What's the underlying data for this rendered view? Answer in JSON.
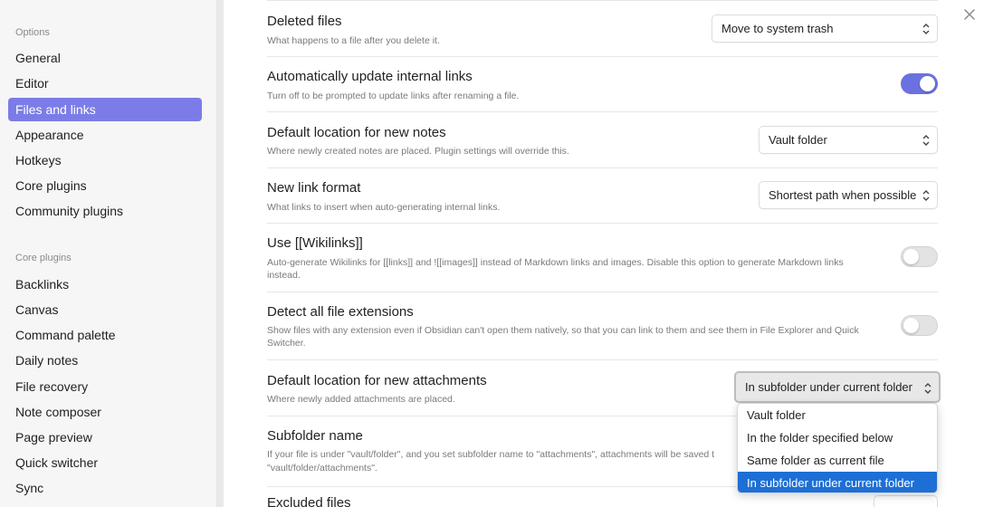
{
  "sidebar": {
    "options_heading": "Options",
    "options_items": [
      {
        "label": "General"
      },
      {
        "label": "Editor"
      },
      {
        "label": "Files and links"
      },
      {
        "label": "Appearance"
      },
      {
        "label": "Hotkeys"
      },
      {
        "label": "Core plugins"
      },
      {
        "label": "Community plugins"
      }
    ],
    "core_heading": "Core plugins",
    "core_items": [
      {
        "label": "Backlinks"
      },
      {
        "label": "Canvas"
      },
      {
        "label": "Command palette"
      },
      {
        "label": "Daily notes"
      },
      {
        "label": "File recovery"
      },
      {
        "label": "Note composer"
      },
      {
        "label": "Page preview"
      },
      {
        "label": "Quick switcher"
      },
      {
        "label": "Sync"
      }
    ],
    "active_item": "Files and links"
  },
  "settings": {
    "deleted_files": {
      "name": "Deleted files",
      "desc": "What happens to a file after you delete it.",
      "value": "Move to system trash"
    },
    "auto_update_links": {
      "name": "Automatically update internal links",
      "desc": "Turn off to be prompted to update links after renaming a file.",
      "enabled": true
    },
    "default_new_notes": {
      "name": "Default location for new notes",
      "desc": "Where newly created notes are placed. Plugin settings will override this.",
      "value": "Vault folder"
    },
    "new_link_format": {
      "name": "New link format",
      "desc": "What links to insert when auto-generating internal links.",
      "value": "Shortest path when possible"
    },
    "use_wikilinks": {
      "name": "Use [[Wikilinks]]",
      "desc_line1": "Auto-generate Wikilinks for [[links]] and ![[images]] instead of Markdown links and images. Disable this option to generate Markdown links",
      "desc_line2": "instead.",
      "enabled": false
    },
    "detect_extensions": {
      "name": "Detect all file extensions",
      "desc_line1": "Show files with any extension even if Obsidian can't open them natively, so that you can link to them and see them in File Explorer and Quick",
      "desc_line2": "Switcher.",
      "enabled": false
    },
    "attachments_location": {
      "name": "Default location for new attachments",
      "desc": "Where newly added attachments are placed.",
      "value": "In subfolder under current folder",
      "options": [
        {
          "label": "Vault folder"
        },
        {
          "label": "In the folder specified below"
        },
        {
          "label": "Same folder as current file"
        },
        {
          "label": "In subfolder under current folder"
        }
      ],
      "selected_index": 3
    },
    "subfolder_name": {
      "name": "Subfolder name",
      "desc_line1": "If your file is under \"vault/folder\", and you set subfolder name to \"attachments\", attachments will be saved t",
      "desc_line2": "\"vault/folder/attachments\"."
    },
    "excluded_files": {
      "name": "Excluded files"
    }
  },
  "colors": {
    "accent": "#7c7ce8",
    "toggle_on": "#6b71e0",
    "dropdown_selected": "#1d6fd6"
  },
  "icons": {
    "close": "close-icon",
    "select_chevron": "chevron-up-down-icon"
  }
}
